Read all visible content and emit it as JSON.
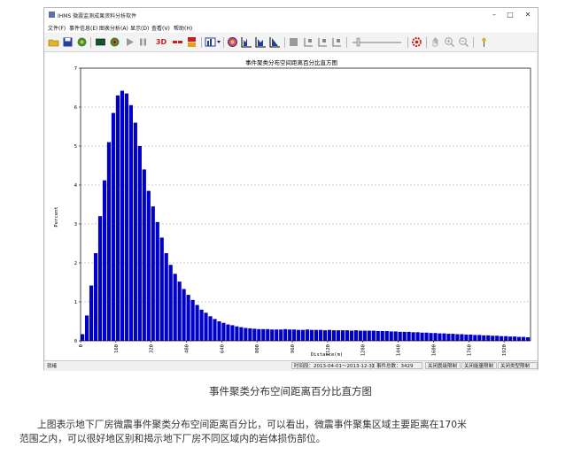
{
  "window": {
    "title": "IHMS 微震监测成果资料分析软件",
    "controls": {
      "minimize": "–",
      "maximize": "□",
      "close": "✕"
    }
  },
  "menu": [
    "文件(F)",
    "事件信息(E)",
    "图表分析(A)",
    "显示(D)",
    "查看(V)",
    "帮助(H)"
  ],
  "toolbar": {
    "icons": [
      "open-folder-icon",
      "save-icon",
      "globe-icon",
      "rectangle-icon",
      "target-icon",
      "play-icon",
      "pause-icon",
      "3d-label",
      "stats-icon",
      "3d-stats-icon",
      "histogram-icon",
      "sphere-icon",
      "chart-a-icon",
      "chart-b-icon",
      "chart-c-icon",
      "stop-icon",
      "export-1-icon",
      "export-2-icon",
      "export-3-icon",
      "slider",
      "gear-icon",
      "hand-icon",
      "zoom-in-icon",
      "zoom-out-icon",
      "pin-icon"
    ],
    "label_3d": "3D",
    "colors": {
      "accent_red": "#c81e1e",
      "bar_blue": "#0000c8"
    }
  },
  "chart_data": {
    "type": "bar",
    "title": "事件聚类分布空间距离百分比直方图",
    "xlabel": "Distance(m)",
    "ylabel": "Percent",
    "ylim": [
      0,
      7
    ],
    "yticks": [
      0,
      1,
      2,
      3,
      4,
      5,
      6,
      7
    ],
    "xlim": [
      0,
      2040
    ],
    "xticks": [
      0,
      160,
      320,
      480,
      640,
      800,
      960,
      1120,
      1280,
      1440,
      1600,
      1760,
      1920
    ],
    "bin_width": 20,
    "grid": "horizontal-dashed",
    "color": "#0000c8",
    "values": [
      0.17,
      0.65,
      1.42,
      2.25,
      3.2,
      4.12,
      5.1,
      5.85,
      6.3,
      6.42,
      6.35,
      6.05,
      5.6,
      5.0,
      4.4,
      3.85,
      3.45,
      3.05,
      2.65,
      2.25,
      1.95,
      1.72,
      1.52,
      1.33,
      1.18,
      1.05,
      0.92,
      0.8,
      0.72,
      0.63,
      0.56,
      0.5,
      0.46,
      0.42,
      0.4,
      0.37,
      0.35,
      0.33,
      0.32,
      0.31,
      0.3,
      0.3,
      0.3,
      0.29,
      0.29,
      0.29,
      0.3,
      0.29,
      0.29,
      0.28,
      0.28,
      0.29,
      0.28,
      0.28,
      0.28,
      0.27,
      0.28,
      0.27,
      0.27,
      0.27,
      0.27,
      0.26,
      0.27,
      0.26,
      0.26,
      0.26,
      0.26,
      0.25,
      0.25,
      0.25,
      0.24,
      0.24,
      0.23,
      0.23,
      0.23,
      0.22,
      0.22,
      0.21,
      0.21,
      0.2,
      0.2,
      0.19,
      0.19,
      0.18,
      0.18,
      0.17,
      0.17,
      0.16,
      0.16,
      0.15,
      0.15,
      0.14,
      0.14,
      0.13,
      0.13,
      0.12,
      0.12,
      0.11,
      0.11,
      0.1,
      0.1,
      0.09
    ]
  },
  "status": {
    "ready": "就绪",
    "time_range": "时间段：2013-04-01～2013-12-31",
    "event_total": "事件总数：3429",
    "close_1": "关闭震级限制",
    "close_2": "关闭能量限制",
    "close_3": "关闭类型限制"
  },
  "caption": "事件聚类分布空间距离百分比直方图",
  "paragraph": {
    "line1": "上图表示地下厂房微震事件聚类分布空间距离百分比，可以看出，微震事件聚集区域主要距离在170米",
    "line2": "范围之内，可以很好地区别和揭示地下厂房不同区域内的岩体损伤部位。"
  }
}
